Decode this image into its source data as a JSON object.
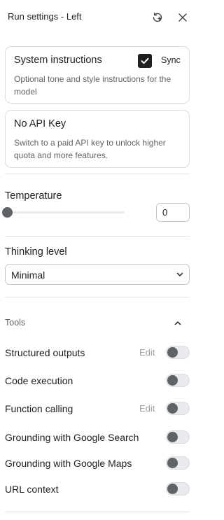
{
  "header": {
    "title": "Run settings - Left",
    "reset_icon": "reset-settings-icon",
    "close_icon": "close-icon"
  },
  "system_instructions": {
    "title": "System instructions",
    "description": "Optional tone and style instructions for the model",
    "sync_label": "Sync",
    "sync_checked": true
  },
  "api_key": {
    "title": "No API Key",
    "description": "Switch to a paid API key to unlock higher quota and more features."
  },
  "temperature": {
    "label": "Temperature",
    "value": "0",
    "slider_fraction": 0
  },
  "thinking": {
    "label": "Thinking level",
    "selected": "Minimal"
  },
  "tools": {
    "label": "Tools",
    "expanded": true,
    "items": [
      {
        "label": "Structured outputs",
        "edit": "Edit",
        "enabled": false
      },
      {
        "label": "Code execution",
        "edit": "",
        "enabled": false
      },
      {
        "label": "Function calling",
        "edit": "Edit",
        "enabled": false
      },
      {
        "label": "Grounding with Google Search",
        "edit": "",
        "enabled": false
      },
      {
        "label": "Grounding with Google Maps",
        "edit": "",
        "enabled": false
      },
      {
        "label": "URL context",
        "edit": "",
        "enabled": false
      }
    ]
  },
  "colors": {
    "text": "#1f1f1f",
    "muted": "#5f6368",
    "border": "#dadce0"
  }
}
